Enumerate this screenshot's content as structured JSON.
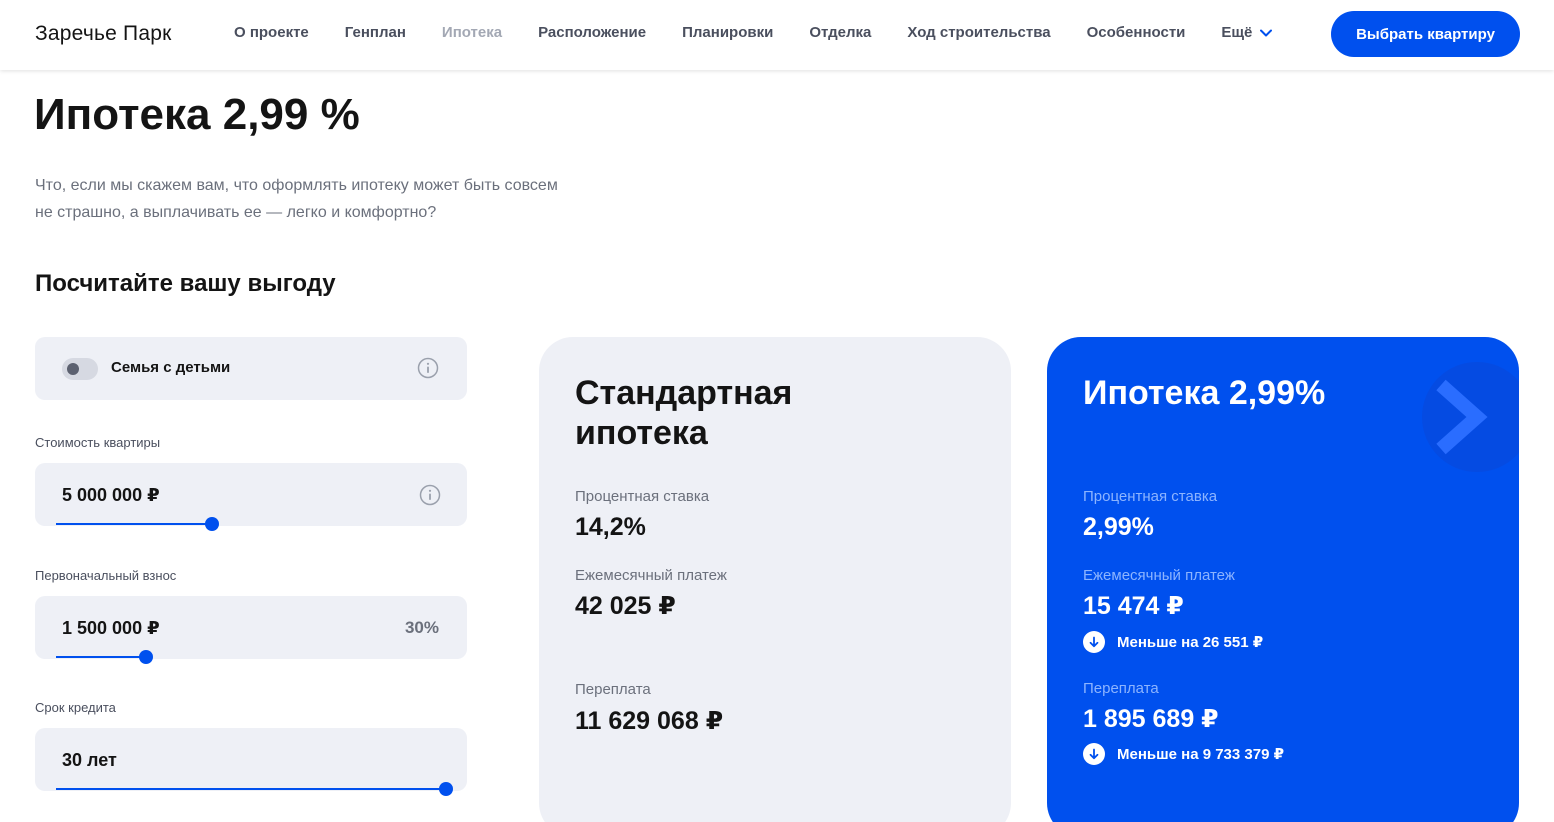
{
  "header": {
    "logo": "Заречье Парк",
    "nav": [
      {
        "label": "О проекте"
      },
      {
        "label": "Генплан"
      },
      {
        "label": "Ипотека",
        "active": true
      },
      {
        "label": "Расположение"
      },
      {
        "label": "Планировки"
      },
      {
        "label": "Отделка"
      },
      {
        "label": "Ход строительства"
      },
      {
        "label": "Особенности"
      }
    ],
    "more_label": "Ещё",
    "cta_label": "Выбрать квартиру"
  },
  "intro": {
    "title": "Ипотека 2,99 %",
    "text": "Что, если мы скажем вам, что оформлять ипотеку может быть совсем не страшно, а выплачивать ее — легко и комфортно?"
  },
  "calculator": {
    "section_title": "Посчитайте вашу выгоду",
    "family_toggle": {
      "label": "Семья с детьми",
      "checked": false
    },
    "price": {
      "label": "Стоимость квартиры",
      "value": "5 000 000 ₽",
      "slider_fraction": 0.4
    },
    "down_payment": {
      "label": "Первоначальный взнос",
      "value": "1 500 000 ₽",
      "percent": "30%",
      "slider_fraction": 0.23
    },
    "term": {
      "label": "Срок кредита",
      "value": "30 лет",
      "slider_fraction": 1.0
    }
  },
  "standard_card": {
    "title": "Стандартная ипотека",
    "rate_label": "Процентная ставка",
    "rate_value": "14,2%",
    "payment_label": "Ежемесячный платеж",
    "payment_value": "42 025 ₽",
    "overpay_label": "Переплата",
    "overpay_value": "11 629 068 ₽"
  },
  "promo_card": {
    "title": "Ипотека 2,99%",
    "rate_label": "Процентная ставка",
    "rate_value": "2,99%",
    "payment_label": "Ежемесячный платеж",
    "payment_value": "15 474 ₽",
    "payment_less": "Меньше на 26 551 ₽",
    "overpay_label": "Переплата",
    "overpay_value": "1 895 689 ₽",
    "overpay_less": "Меньше на 9 733 379 ₽"
  },
  "colors": {
    "accent": "#0050ee",
    "card_bg": "#eef0f6",
    "muted_text": "#6b707c"
  },
  "icons": {
    "info": "info-circle-icon",
    "chevron": "chevron-down-icon",
    "arrow_down": "arrow-down-circle-icon"
  }
}
